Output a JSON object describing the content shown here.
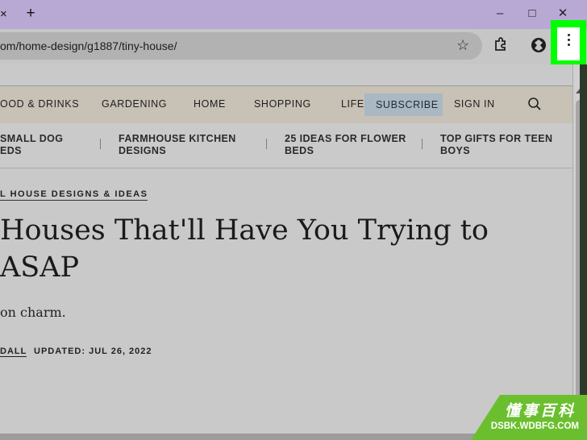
{
  "browser": {
    "tab_close_glyph": "×",
    "new_tab_glyph": "+",
    "window": {
      "minimize_glyph": "–",
      "maximize_glyph": "□",
      "close_glyph": "✕"
    },
    "url": "om/home-design/g1887/tiny-house/",
    "icons": [
      "star-icon",
      "extensions-icon",
      "profile-icon",
      "more-menu-icon"
    ],
    "highlight_color": "#00ff00"
  },
  "site_nav": {
    "items": [
      "OOD & DRINKS",
      "GARDENING",
      "HOME",
      "SHOPPING",
      "LIFE"
    ],
    "subscribe_label": "SUBSCRIBE",
    "sign_in_label": "SIGN IN"
  },
  "trending": [
    {
      "line1": "SMALL DOG",
      "line2": "EDS"
    },
    {
      "line1": "FARMHOUSE KITCHEN",
      "line2": "DESIGNS"
    },
    {
      "line1": "25 IDEAS FOR FLOWER",
      "line2": "BEDS"
    },
    {
      "line1": "TOP GIFTS FOR TEEN",
      "line2": "BOYS"
    }
  ],
  "article": {
    "breadcrumb": "L HOUSE DESIGNS & IDEAS",
    "headline_line1": "Houses That'll Have You Trying to",
    "headline_line2": "ASAP",
    "dek": "on charm.",
    "byline": "DALL",
    "updated": "UPDATED: JUL 26, 2022"
  },
  "watermark": {
    "cn": "懂事百科",
    "en": "DSBK.WDBFG.COM"
  }
}
